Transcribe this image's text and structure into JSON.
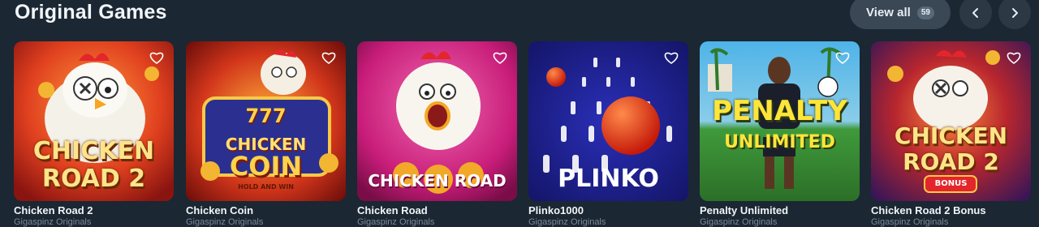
{
  "section": {
    "title": "Original Games",
    "view_all_label": "View all",
    "count": "59"
  },
  "colors": {
    "background": "#1b2733",
    "button": "#3a4856",
    "nav_button": "#2c3844"
  },
  "games": [
    {
      "name": "Chicken Road 2",
      "provider": "Gigaspinz Originals",
      "art_text": [
        "CHICKEN",
        "ROAD 2"
      ]
    },
    {
      "name": "Chicken Coin",
      "provider": "Gigaspinz Originals",
      "art_text": [
        "777",
        "CHICKEN",
        "COIN",
        "HOLD AND WIN"
      ]
    },
    {
      "name": "Chicken Road",
      "provider": "Gigaspinz Originals",
      "art_text": [
        "CHICKEN ROAD"
      ]
    },
    {
      "name": "Plinko1000",
      "provider": "Gigaspinz Originals",
      "art_text": [
        "PLINKO"
      ]
    },
    {
      "name": "Penalty Unlimited",
      "provider": "Gigaspinz Originals",
      "art_text": [
        "PENALTY",
        "UNLIMITED"
      ]
    },
    {
      "name": "Chicken Road 2 Bonus",
      "provider": "Gigaspinz Originals",
      "art_text": [
        "CHICKEN",
        "ROAD 2",
        "BONUS"
      ]
    }
  ],
  "icons": {
    "favorite": "heart-icon",
    "prev": "chevron-left-icon",
    "next": "chevron-right-icon"
  }
}
